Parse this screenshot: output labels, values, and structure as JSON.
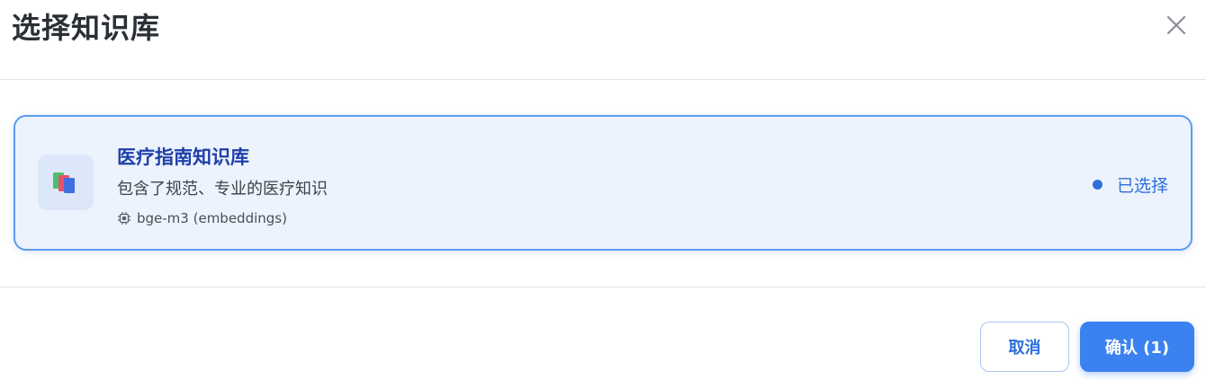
{
  "dialog": {
    "title": "选择知识库",
    "close_icon": "close-icon"
  },
  "knowledge_bases": [
    {
      "name": "医疗指南知识库",
      "description": "包含了规范、专业的医疗知识",
      "model": "bge-m3 (embeddings)",
      "status": "已选择",
      "icon": "books-icon",
      "model_icon": "chip-icon",
      "selected": true
    }
  ],
  "footer": {
    "cancel_label": "取消",
    "confirm_label": "确认 (1)"
  },
  "colors": {
    "accent": "#3b82f0",
    "card_border": "#5b9cf0",
    "card_bg": "#edf3fd",
    "title_text": "#1f3fa8"
  }
}
